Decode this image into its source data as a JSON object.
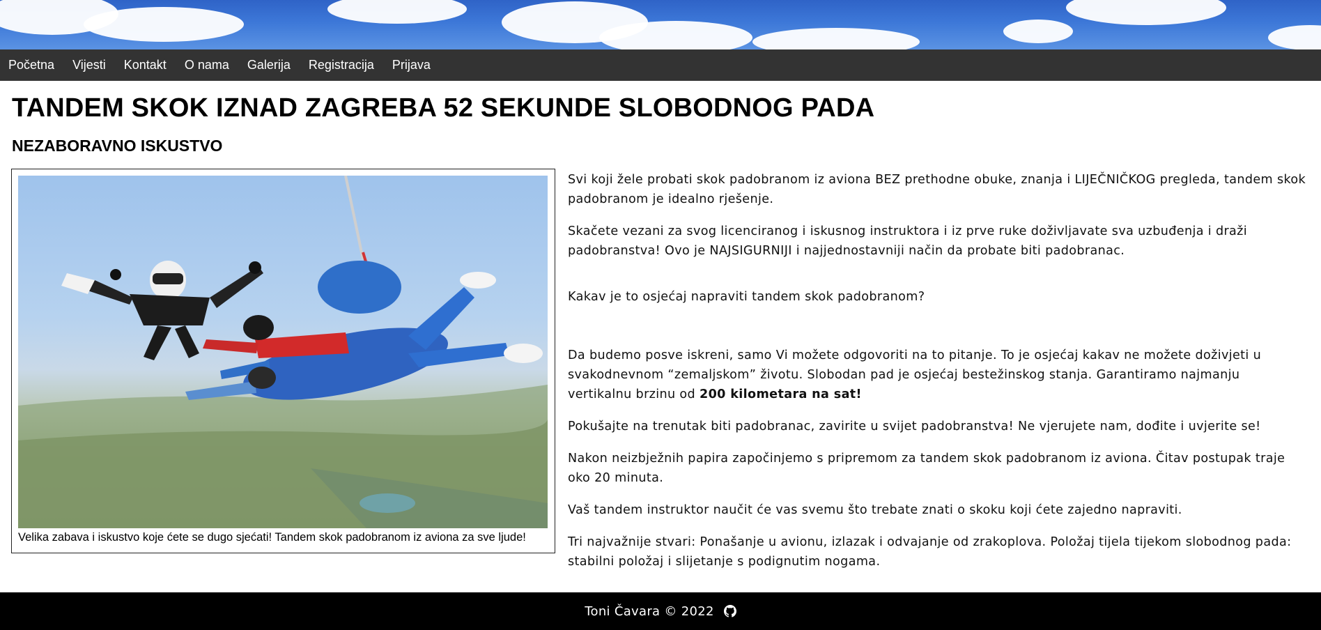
{
  "nav": {
    "items": [
      "Početna",
      "Vijesti",
      "Kontakt",
      "O nama",
      "Galerija",
      "Registracija",
      "Prijava"
    ]
  },
  "main": {
    "title": "TANDEM SKOK IZNAD ZAGREBA 52 SEKUNDE SLOBODNOG PADA",
    "subtitle": "NEZABORAVNO ISKUSTVO",
    "figure": {
      "caption": "Velika zabava i iskustvo koje ćete se dugo sjećati! Tandem skok padobranom iz aviona za sve ljude!"
    },
    "paragraphs": {
      "p1": "Svi koji žele probati skok padobranom iz aviona BEZ prethodne obuke, znanja i LIJEČNIČKOG pregleda, tandem skok padobranom je idealno rješenje.",
      "p2": "Skačete vezani za svog licenciranog i iskusnog instruktora i iz prve ruke doživljavate sva uzbuđenja i draži padobranstva! Ovo je NAJSIGURNIJI i najjednostavniji način da probate biti padobranac.",
      "p3": "Kakav je to osjećaj napraviti tandem skok padobranom?",
      "p4_text": "Da budemo posve iskreni, samo Vi možete odgovoriti na to pitanje. To je osjećaj kakav ne možete doživjeti u svakodnevnom “zemaljskom” životu. Slobodan pad je osjećaj bestežinskog stanja. Garantiramo najmanju vertikalnu brzinu od ",
      "p4_bold": "200 kilometara na sat!",
      "p5": "Pokušajte na trenutak biti padobranac, zavirite u svijet padobranstva! Ne vjerujete nam, dođite i uvjerite se!",
      "p6": "Nakon neizbježnih papira započinjemo s pripremom za tandem skok padobranom iz aviona. Čitav postupak traje oko 20 minuta.",
      "p7": "Vaš tandem instruktor naučit će vas svemu što trebate znati o skoku koji ćete zajedno napraviti.",
      "p8": "Tri najvažnije stvari: Ponašanje u avionu, izlazak i odvajanje od zrakoplova. Položaj tijela tijekom slobodnog pada: stabilni položaj i slijetanje s podignutim nogama."
    }
  },
  "footer": {
    "copyright": "Toni Čavara © 2022",
    "icon": "github-icon"
  },
  "colors": {
    "nav_bg": "#333333",
    "footer_bg": "#000000",
    "sky": "#3d78d8"
  }
}
